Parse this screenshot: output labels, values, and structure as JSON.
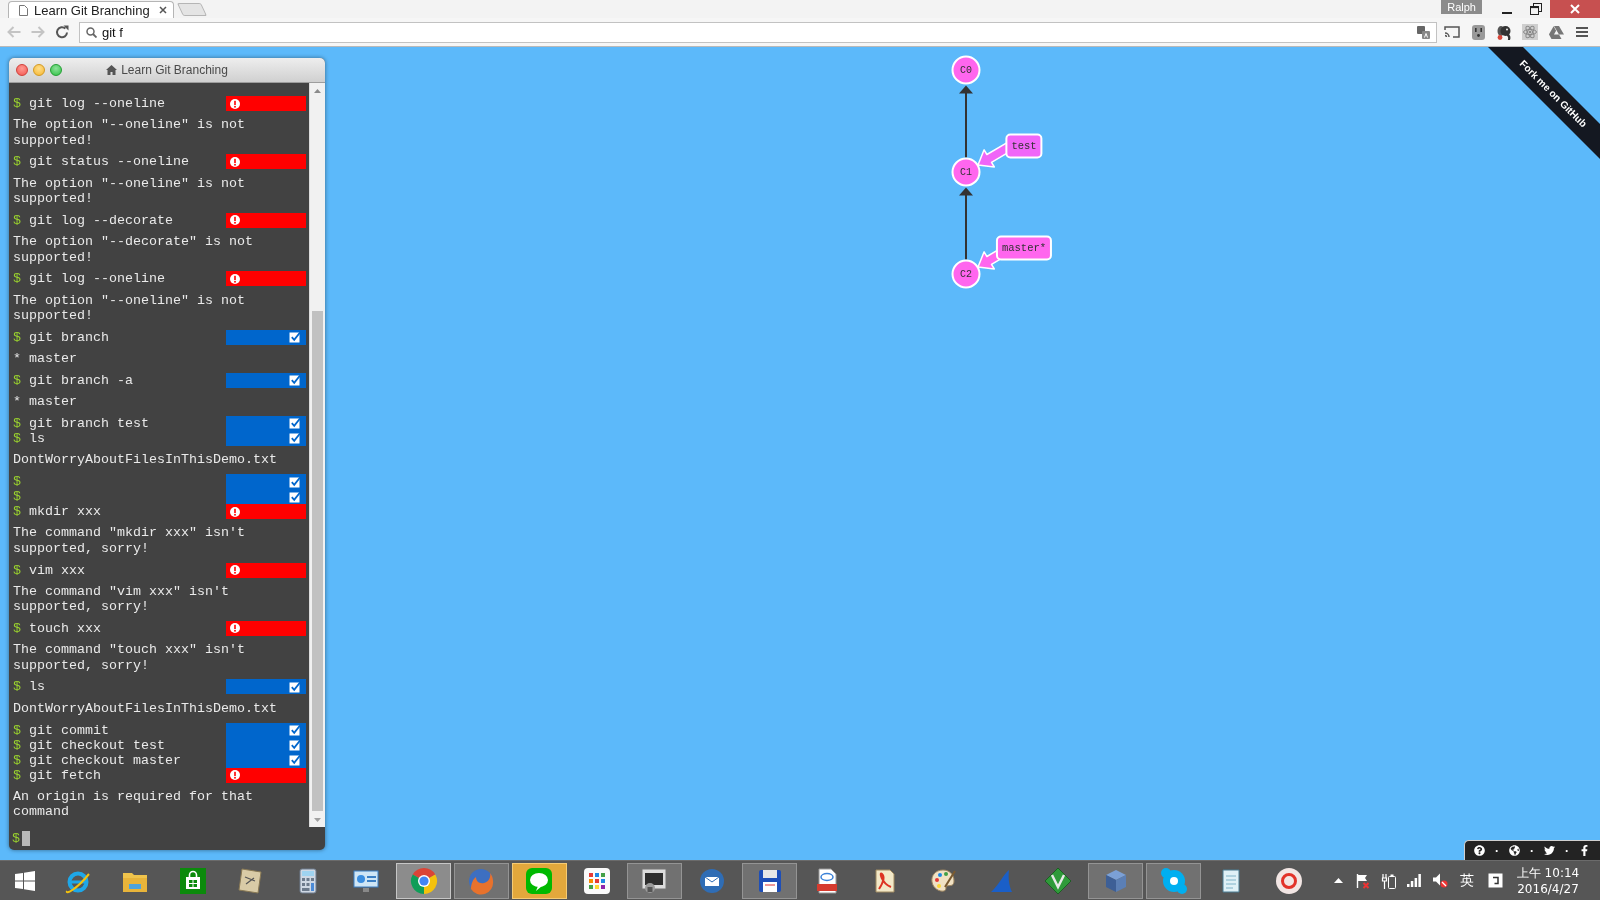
{
  "browser": {
    "tabs": [
      {
        "title": "Learn Git Branching",
        "selected": true
      }
    ],
    "profile": "Ralph",
    "back": {
      "disabled": true
    },
    "forward": {
      "disabled": true
    },
    "address": {
      "value": "git f"
    }
  },
  "terminal": {
    "title": "Learn Git Branching",
    "history": [
      {
        "kind": "command",
        "prompt": "$",
        "text": "git log --oneline",
        "failed": true
      },
      {
        "kind": "output",
        "text": "The option \"--oneline\" is not supported!"
      },
      {
        "kind": "command",
        "prompt": "$",
        "text": "git status --oneline",
        "failed": true
      },
      {
        "kind": "output",
        "text": "The option \"--oneline\" is not supported!"
      },
      {
        "kind": "command",
        "prompt": "$",
        "text": "git log --decorate",
        "failed": true
      },
      {
        "kind": "output",
        "text": "The option \"--decorate\" is not supported!"
      },
      {
        "kind": "command",
        "prompt": "$",
        "text": "git log --oneline",
        "failed": true
      },
      {
        "kind": "output",
        "text": "The option \"--oneline\" is not supported!"
      },
      {
        "kind": "command",
        "prompt": "$",
        "text": "git branch",
        "failed": false
      },
      {
        "kind": "output",
        "text": "* master"
      },
      {
        "kind": "command",
        "prompt": "$",
        "text": "git branch -a",
        "failed": false
      },
      {
        "kind": "output",
        "text": "* master"
      },
      {
        "kind": "command",
        "prompt": "$",
        "text": "git branch test",
        "failed": false
      },
      {
        "kind": "command",
        "prompt": "$",
        "text": "ls",
        "failed": false
      },
      {
        "kind": "output",
        "text": "DontWorryAboutFilesInThisDemo.txt"
      },
      {
        "kind": "command",
        "prompt": "$",
        "failed": false
      },
      {
        "kind": "command",
        "prompt": "$",
        "failed": false
      },
      {
        "kind": "command",
        "prompt": "$",
        "text": "mkdir xxx",
        "failed": true
      },
      {
        "kind": "output",
        "text": "The command \"mkdir xxx\" isn't supported, sorry!"
      },
      {
        "kind": "command",
        "prompt": "$",
        "text": "vim xxx",
        "failed": true
      },
      {
        "kind": "output",
        "text": "The command \"vim xxx\" isn't supported, sorry!"
      },
      {
        "kind": "command",
        "prompt": "$",
        "text": "touch xxx",
        "failed": true
      },
      {
        "kind": "output",
        "text": "The command \"touch xxx\" isn't supported, sorry!"
      },
      {
        "kind": "command",
        "prompt": "$",
        "text": "ls",
        "failed": false
      },
      {
        "kind": "output",
        "text": "DontWorryAboutFilesInThisDemo.txt"
      },
      {
        "kind": "command",
        "prompt": "$",
        "text": "git commit",
        "failed": false
      },
      {
        "kind": "command",
        "prompt": "$",
        "text": "git checkout test",
        "failed": false
      },
      {
        "kind": "command",
        "prompt": "$",
        "text": "git checkout master",
        "failed": false
      },
      {
        "kind": "command",
        "prompt": "$",
        "text": "git fetch",
        "failed": true
      },
      {
        "kind": "output",
        "text": "An origin is required for that command"
      }
    ],
    "input": {
      "prompt": "$"
    }
  },
  "graph": {
    "commits": [
      {
        "label": "C0"
      },
      {
        "label": "C1",
        "branches": [
          {
            "name": "test",
            "color": "#f066f8"
          }
        ]
      },
      {
        "label": "C2",
        "branches": [
          {
            "name": "master*",
            "color": "#ff66ee"
          }
        ]
      }
    ]
  },
  "ribbon": {
    "text": "Fork me on GitHub"
  },
  "helper_bar": {
    "separators": [
      "·",
      "·",
      "·"
    ]
  },
  "taskbar": {
    "apps": [
      {
        "running": false,
        "active": false,
        "flashing": false
      },
      {
        "running": false,
        "active": false,
        "flashing": false
      },
      {
        "running": false,
        "active": false,
        "flashing": false
      },
      {
        "running": false,
        "active": false,
        "flashing": false
      },
      {
        "running": false,
        "active": false,
        "flashing": false
      },
      {
        "running": false,
        "active": false,
        "flashing": false
      },
      {
        "running": true,
        "active": true,
        "flashing": false
      },
      {
        "running": true,
        "active": false,
        "flashing": false
      },
      {
        "running": true,
        "active": false,
        "flashing": true
      },
      {
        "running": false,
        "active": false,
        "flashing": false
      },
      {
        "running": true,
        "active": false,
        "flashing": false
      },
      {
        "running": false,
        "active": false,
        "flashing": false
      },
      {
        "running": true,
        "active": false,
        "flashing": false
      },
      {
        "running": false,
        "active": false,
        "flashing": false
      },
      {
        "running": false,
        "active": false,
        "flashing": false
      },
      {
        "running": false,
        "active": false,
        "flashing": false
      },
      {
        "running": false,
        "active": false,
        "flashing": false
      },
      {
        "running": false,
        "active": false,
        "flashing": false
      },
      {
        "running": true,
        "active": false,
        "flashing": false
      },
      {
        "running": true,
        "active": false,
        "flashing": false
      },
      {
        "running": false,
        "active": false,
        "flashing": false
      },
      {
        "running": false,
        "active": false,
        "flashing": false
      }
    ],
    "tray": {
      "ime": "英",
      "time": "上午 10:14",
      "date": "2016/4/27"
    }
  }
}
